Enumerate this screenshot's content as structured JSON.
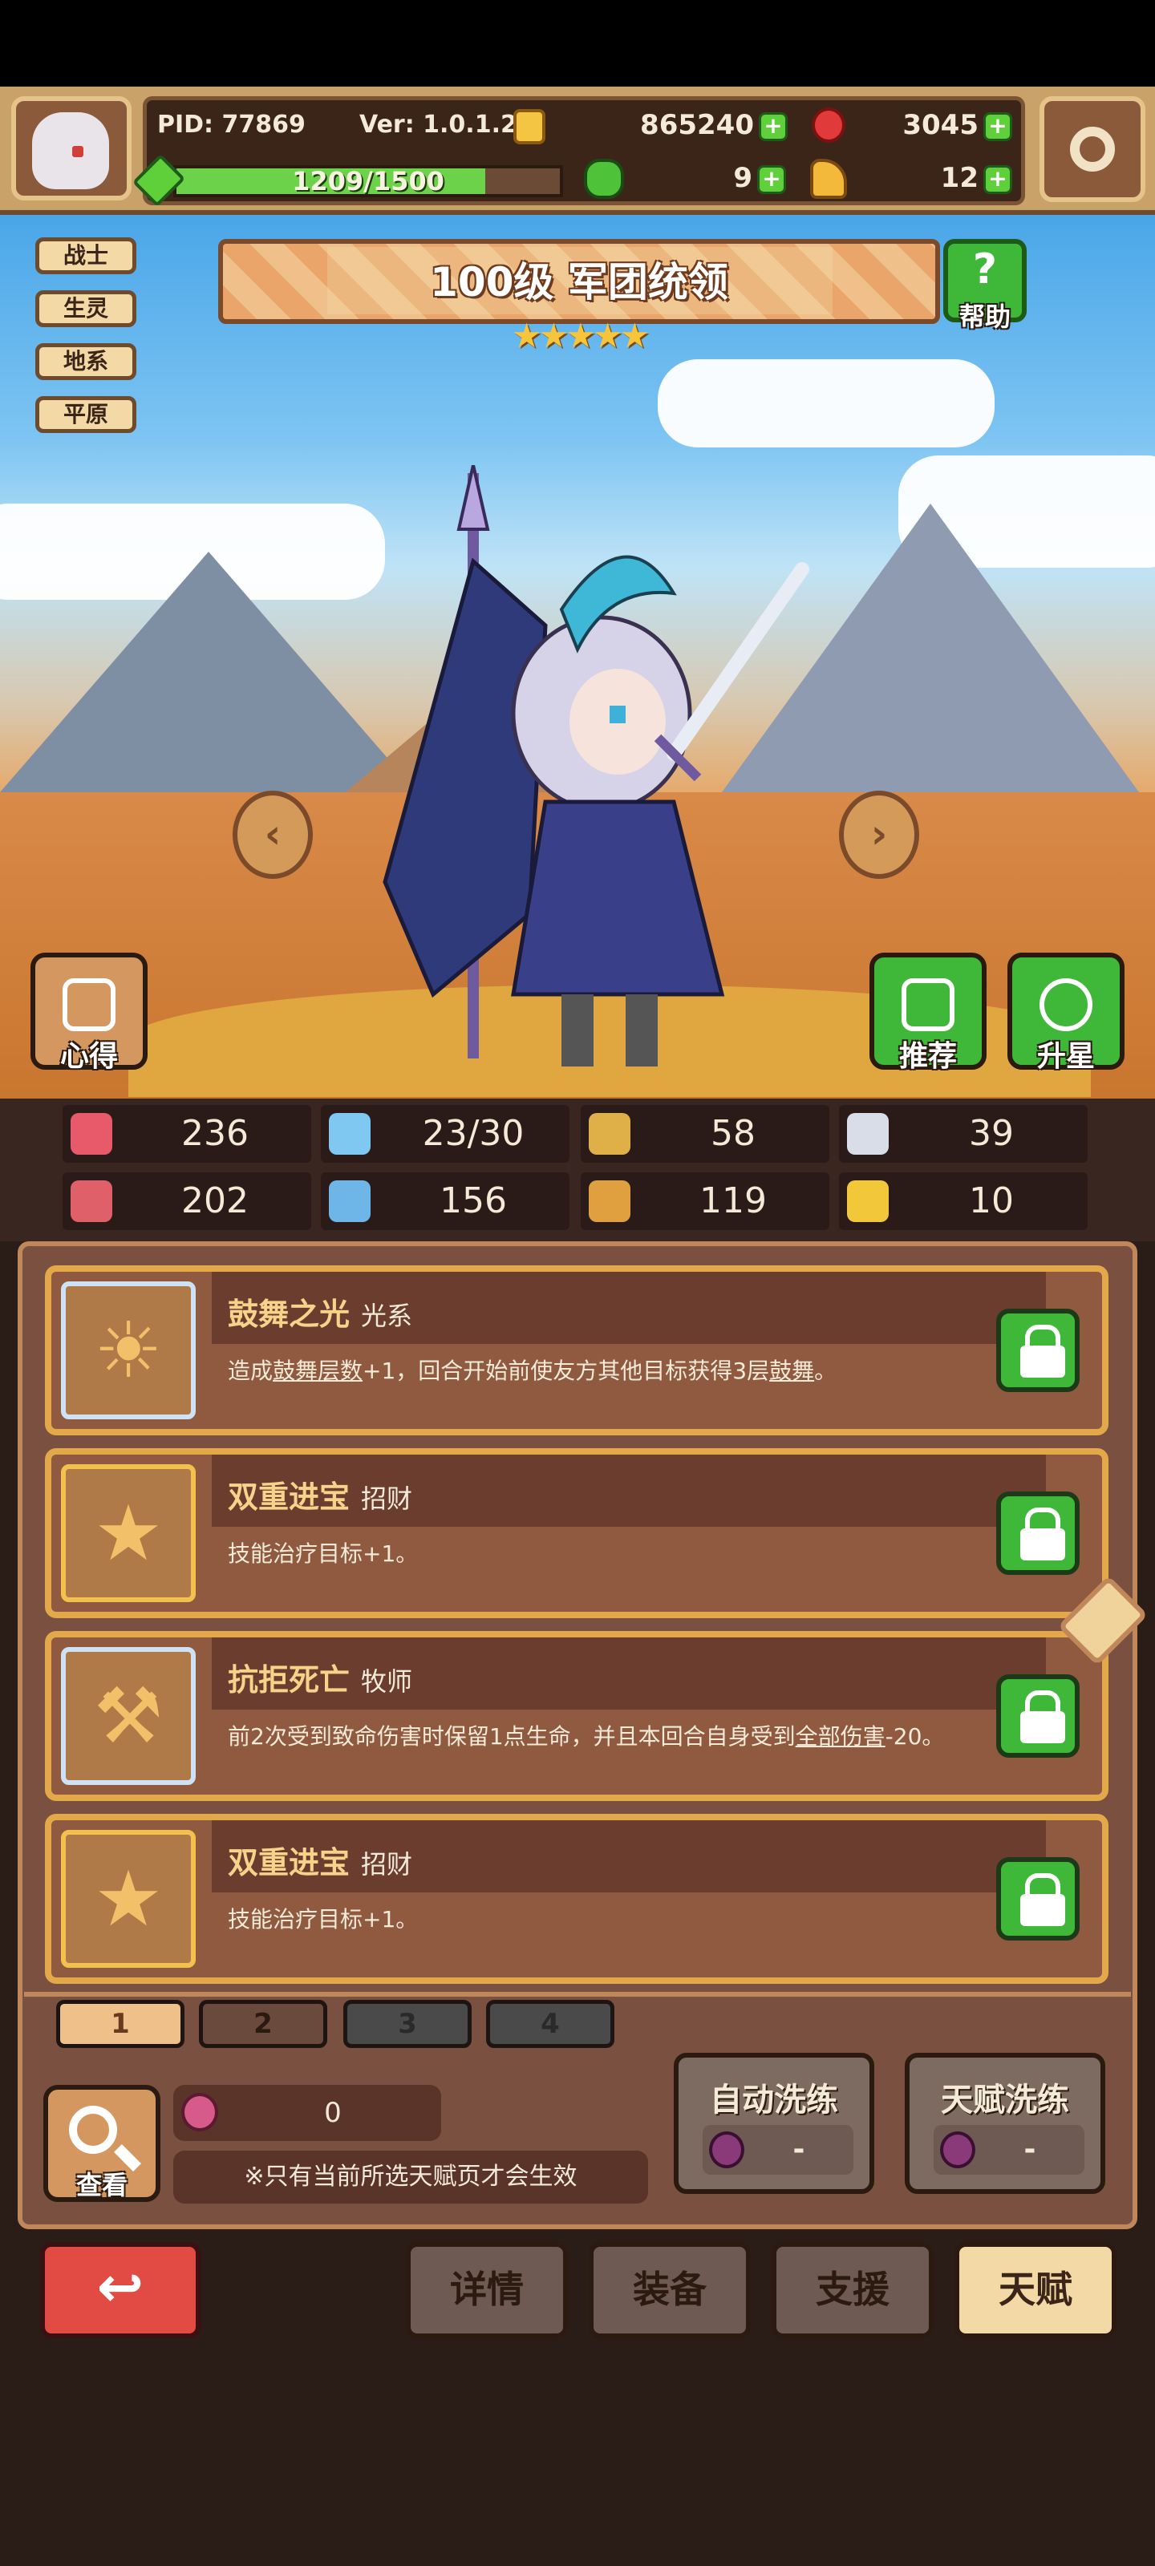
{
  "header": {
    "pid": "PID: 77869",
    "version": "Ver: 1.0.1.2",
    "gold": "865240",
    "gems": "3045",
    "xp": "1209/1500",
    "xp_progress": 0.806,
    "clovers": "9",
    "hands": "12"
  },
  "tags": [
    "战士",
    "生灵",
    "地系",
    "平原"
  ],
  "hero": {
    "title": "100级  军团统领",
    "stars": "★★★★★",
    "star_count": 5,
    "help_label": "帮助",
    "left_button": "心得",
    "recommend_button": "推荐",
    "upgrade_button": "升星"
  },
  "stats": [
    {
      "icon": "heart-icon",
      "value": "236",
      "color": "#e85a6a"
    },
    {
      "icon": "mana-drop-icon",
      "value": "23/30",
      "color": "#7fc8f2"
    },
    {
      "icon": "shield-icon",
      "value": "58",
      "color": "#e0b048"
    },
    {
      "icon": "wing-icon",
      "value": "39",
      "color": "#d8dde8"
    },
    {
      "icon": "fist-icon",
      "value": "202",
      "color": "#e0606a"
    },
    {
      "icon": "book-icon",
      "value": "156",
      "color": "#6fb6e8"
    },
    {
      "icon": "boot-icon",
      "value": "119",
      "color": "#e0a040"
    },
    {
      "icon": "horseshoe-icon",
      "value": "10",
      "color": "#f2c83a"
    }
  ],
  "talents": [
    {
      "name": "鼓舞之光",
      "school": "光系",
      "icon": "sun-icon",
      "frame": "blue",
      "desc": [
        {
          "t": "造成"
        },
        {
          "t": "鼓舞层数",
          "u": true
        },
        {
          "t": "+1，回合开始前使友方其他目标获得3层"
        },
        {
          "t": "鼓舞",
          "u": true
        },
        {
          "t": "。"
        }
      ]
    },
    {
      "name": "双重进宝",
      "school": "招财",
      "icon": "star-icon",
      "frame": "gold",
      "desc": [
        {
          "t": "技能治疗目标+1。"
        }
      ]
    },
    {
      "name": "抗拒死亡",
      "school": "牧师",
      "icon": "hammer-icon",
      "frame": "blue",
      "desc": [
        {
          "t": "前2次受到致命伤害时保留1点生命，并且本回合自身受到"
        },
        {
          "t": "全部伤害",
          "u": true
        },
        {
          "t": "-20。"
        }
      ]
    },
    {
      "name": "双重进宝",
      "school": "招财",
      "icon": "star-icon",
      "frame": "gold",
      "desc": [
        {
          "t": "技能治疗目标+1。"
        }
      ]
    }
  ],
  "pages": [
    "1",
    "2",
    "3",
    "4"
  ],
  "active_page": "1",
  "bottom": {
    "view_label": "查看",
    "berry_count": "0",
    "note": "※只有当前所选天赋页才会生效",
    "auto_reroll": "自动洗练",
    "auto_reroll_cost": "-",
    "talent_reroll": "天赋洗练",
    "talent_reroll_cost": "-"
  },
  "nav": {
    "back_icon": "↩",
    "details": "详情",
    "equipment": "装备",
    "support": "支援",
    "talent": "天赋",
    "active": "talent"
  }
}
